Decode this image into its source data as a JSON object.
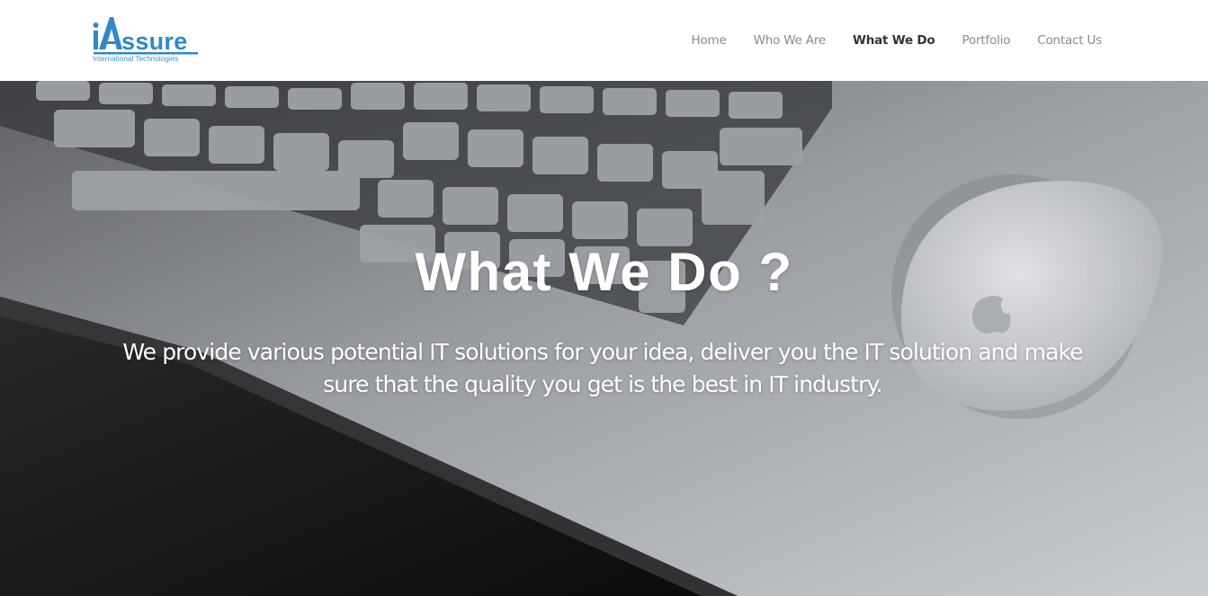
{
  "header": {
    "logo": {
      "name": "iAssure",
      "tagline": "International Technologies",
      "brand_color": "#2f88c8"
    },
    "nav": [
      {
        "label": "Home",
        "active": false
      },
      {
        "label": "Who We Are",
        "active": false
      },
      {
        "label": "What We Do",
        "active": true
      },
      {
        "label": "Portfolio",
        "active": false
      },
      {
        "label": "Contact Us",
        "active": false
      }
    ]
  },
  "hero": {
    "title": "What We Do ?",
    "subtitle": "We provide various potential IT solutions for your idea, deliver you the IT solution and make sure that the quality you get is the best in IT industry.",
    "background": "keyboard-and-mouse-photo"
  }
}
